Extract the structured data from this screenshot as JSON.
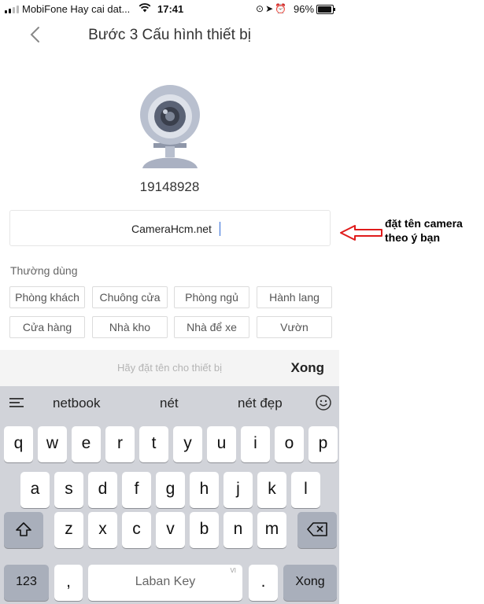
{
  "status_bar": {
    "carrier": "MobiFone Hay cai dat...",
    "time": "17:41",
    "battery_percent_label": "96%",
    "battery_level": 0.96,
    "icons": [
      "signal-icon",
      "wifi-icon",
      "screen-lock-icon",
      "location-icon",
      "alarm-icon",
      "battery-icon"
    ]
  },
  "header": {
    "title": "Bước 3 Cấu hình thiết bị",
    "back_icon": "chevron-left-icon"
  },
  "device": {
    "icon": "webcam-icon",
    "serial": "19148928"
  },
  "name_input": {
    "value": "CameraHcm.net"
  },
  "common": {
    "label": "Thường dùng",
    "chips": [
      "Phòng khách",
      "Chuông cửa",
      "Phòng ngủ",
      "Hành lang",
      "Cửa hàng",
      "Nhà kho",
      "Nhà để xe",
      "Vườn"
    ]
  },
  "suggestion_bar": {
    "placeholder": "Hãy đặt tên cho thiết bị",
    "done_label": "Xong"
  },
  "keyboard": {
    "predictions": [
      "netbook",
      "nét",
      "nét đẹp"
    ],
    "row1": [
      "q",
      "w",
      "e",
      "r",
      "t",
      "y",
      "u",
      "i",
      "o",
      "p"
    ],
    "row2": [
      "a",
      "s",
      "d",
      "f",
      "g",
      "h",
      "j",
      "k",
      "l"
    ],
    "row3": [
      "z",
      "x",
      "c",
      "v",
      "b",
      "n",
      "m"
    ],
    "numbers_label": "123",
    "comma_label": ",",
    "space_label": "Laban Key",
    "space_tag": "VI",
    "period_label": ".",
    "return_label": "Xong"
  },
  "annotation": {
    "note_line1": "đặt tên camera",
    "note_line2": "theo ý bạn",
    "arrow_color": "#e01b1b"
  }
}
